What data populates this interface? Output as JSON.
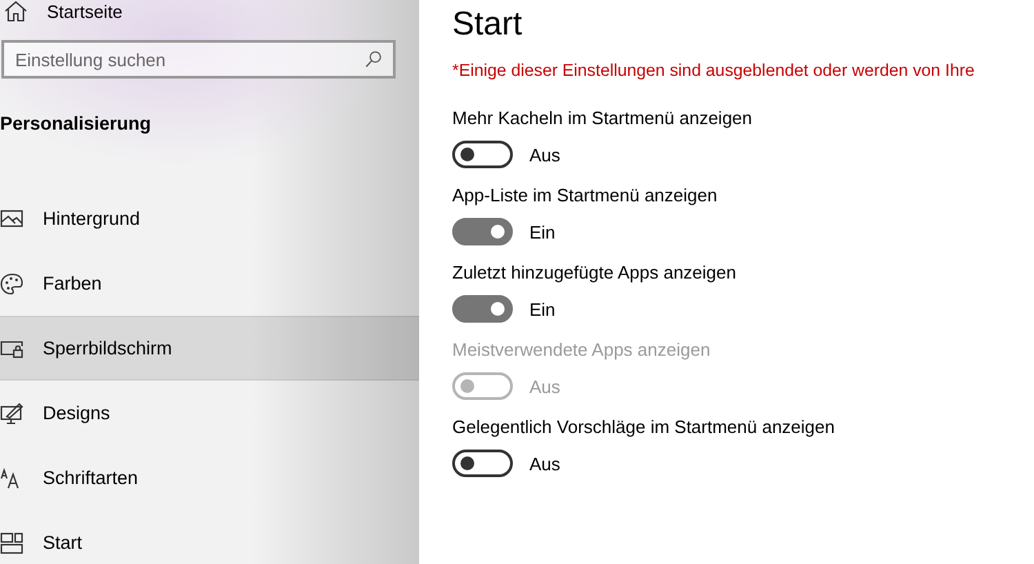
{
  "sidebar": {
    "home": "Startseite",
    "search": {
      "placeholder": "Einstellung suchen"
    },
    "section_title": "Personalisierung",
    "items": [
      {
        "label": "Hintergrund",
        "kind": "picture",
        "selected": false
      },
      {
        "label": "Farben",
        "kind": "palette",
        "selected": false
      },
      {
        "label": "Sperrbildschirm",
        "kind": "lock-screen",
        "selected": true
      },
      {
        "label": "Designs",
        "kind": "brush",
        "selected": false
      },
      {
        "label": "Schriftarten",
        "kind": "font",
        "selected": false
      },
      {
        "label": "Start",
        "kind": "tiles",
        "selected": false
      }
    ]
  },
  "main": {
    "title": "Start",
    "warning": "*Einige dieser Einstellungen sind ausgeblendet oder werden von Ihre",
    "settings": [
      {
        "label": "Mehr Kacheln im Startmenü anzeigen",
        "on": false,
        "disabled": false,
        "state_text": "Aus"
      },
      {
        "label": "App-Liste im Startmenü anzeigen",
        "on": true,
        "disabled": false,
        "state_text": "Ein"
      },
      {
        "label": "Zuletzt hinzugefügte Apps anzeigen",
        "on": true,
        "disabled": false,
        "state_text": "Ein"
      },
      {
        "label": "Meistverwendete Apps anzeigen",
        "on": false,
        "disabled": true,
        "state_text": "Aus"
      },
      {
        "label": "Gelegentlich Vorschläge im Startmenü anzeigen",
        "on": false,
        "disabled": false,
        "state_text": "Aus"
      }
    ]
  }
}
